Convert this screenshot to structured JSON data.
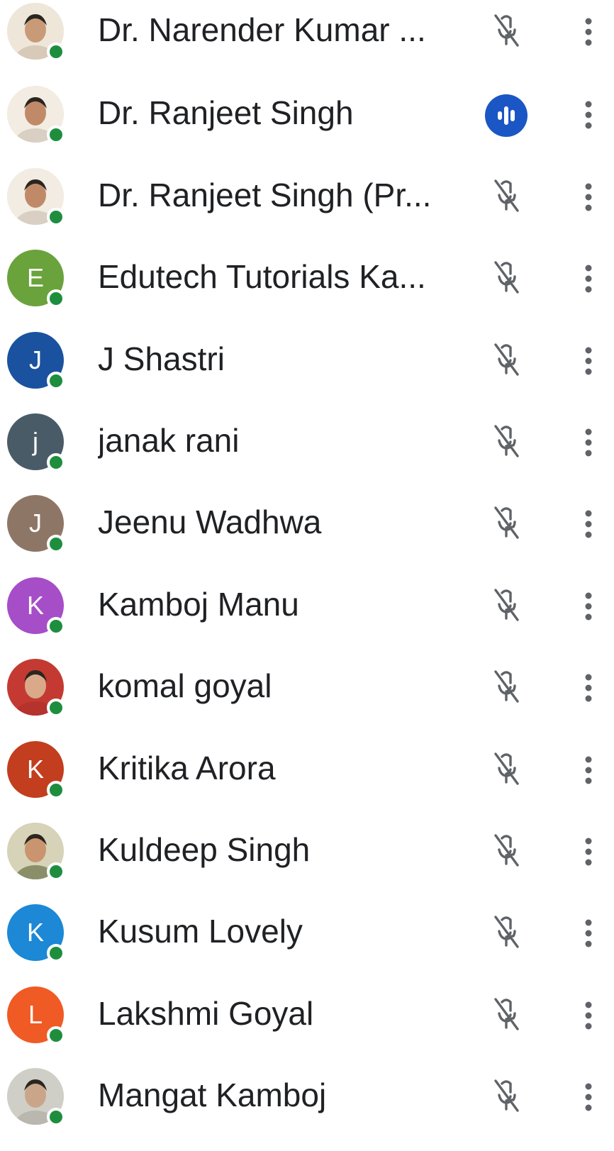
{
  "participants": [
    {
      "name": "Dr. Narender Kumar ...",
      "avatar_type": "photo",
      "avatar_letter": "",
      "avatar_color": "#d8c9b8",
      "mic": "muted",
      "online": true
    },
    {
      "name": "Dr. Ranjeet Singh",
      "avatar_type": "photo",
      "avatar_letter": "",
      "avatar_color": "#d9cfc3",
      "mic": "speaking",
      "online": true
    },
    {
      "name": "Dr. Ranjeet Singh (Pr...",
      "avatar_type": "photo",
      "avatar_letter": "",
      "avatar_color": "#d9cfc3",
      "mic": "muted",
      "online": true
    },
    {
      "name": "Edutech Tutorials Ka...",
      "avatar_type": "letter",
      "avatar_letter": "E",
      "avatar_color": "#6aa23c",
      "mic": "muted",
      "online": true
    },
    {
      "name": "J Shastri",
      "avatar_type": "letter",
      "avatar_letter": "J",
      "avatar_color": "#1a52a0",
      "mic": "muted",
      "online": true
    },
    {
      "name": "janak rani",
      "avatar_type": "letter",
      "avatar_letter": "j",
      "avatar_color": "#4a5b68",
      "mic": "muted",
      "online": true
    },
    {
      "name": "Jeenu Wadhwa",
      "avatar_type": "letter",
      "avatar_letter": "J",
      "avatar_color": "#8e7667",
      "mic": "muted",
      "online": true
    },
    {
      "name": "Kamboj Manu",
      "avatar_type": "letter",
      "avatar_letter": "K",
      "avatar_color": "#a64dc8",
      "mic": "muted",
      "online": true
    },
    {
      "name": "komal goyal",
      "avatar_type": "photo",
      "avatar_letter": "",
      "avatar_color": "#b5322d",
      "mic": "muted",
      "online": true
    },
    {
      "name": "Kritika Arora",
      "avatar_type": "letter",
      "avatar_letter": "K",
      "avatar_color": "#c23e1e",
      "mic": "muted",
      "online": true
    },
    {
      "name": "Kuldeep Singh",
      "avatar_type": "photo",
      "avatar_letter": "",
      "avatar_color": "#8a8f6a",
      "mic": "muted",
      "online": true
    },
    {
      "name": "Kusum Lovely",
      "avatar_type": "letter",
      "avatar_letter": "K",
      "avatar_color": "#1c88d6",
      "mic": "muted",
      "online": true
    },
    {
      "name": "Lakshmi Goyal",
      "avatar_type": "letter",
      "avatar_letter": "L",
      "avatar_color": "#f05a24",
      "mic": "muted",
      "online": true
    },
    {
      "name": "Mangat Kamboj",
      "avatar_type": "photo",
      "avatar_letter": "",
      "avatar_color": "#b9b7ae",
      "mic": "muted",
      "online": true
    }
  ],
  "icons": {
    "mic_muted": "mic-off-icon",
    "mic_speaking": "speaking-indicator-icon",
    "more": "more-vert-icon",
    "online": "online-status-dot"
  },
  "colors": {
    "text": "#202124",
    "icon_gray": "#5f6368",
    "online_green": "#1e8e3e",
    "speaking_blue": "#1a56c4"
  }
}
